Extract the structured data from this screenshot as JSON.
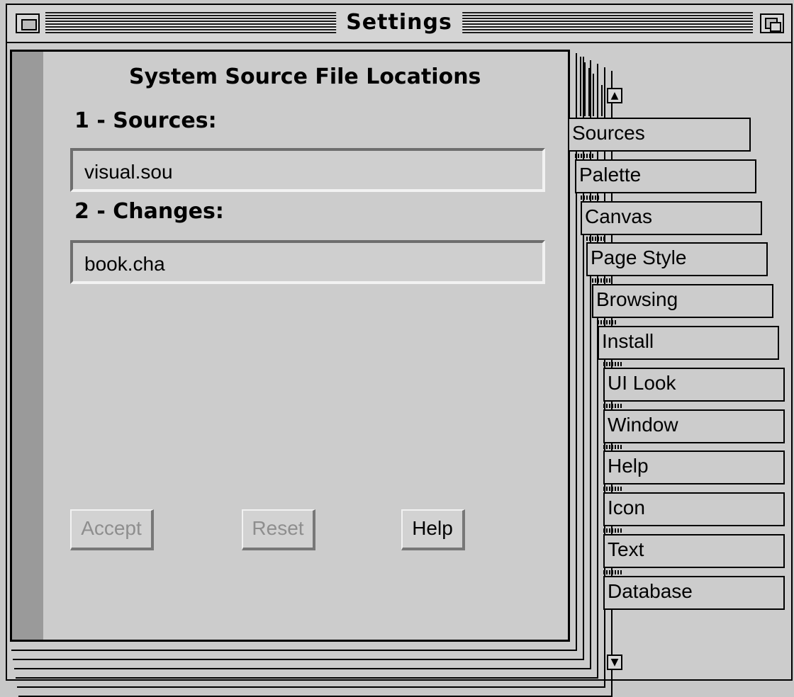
{
  "window": {
    "title": "Settings"
  },
  "panel": {
    "title": "System Source File Locations",
    "sources_label": "1 - Sources:",
    "sources_value": "visual.sou",
    "changes_label": "2 - Changes:",
    "changes_value": "book.cha"
  },
  "buttons": {
    "accept": "Accept",
    "reset": "Reset",
    "help": "Help"
  },
  "tabs": [
    {
      "label": "Sources",
      "active": true
    },
    {
      "label": "Palette"
    },
    {
      "label": "Canvas"
    },
    {
      "label": "Page Style"
    },
    {
      "label": "Browsing"
    },
    {
      "label": "Install"
    },
    {
      "label": "UI Look"
    },
    {
      "label": "Window"
    },
    {
      "label": "Help"
    },
    {
      "label": "Icon"
    },
    {
      "label": "Text"
    },
    {
      "label": "Database"
    }
  ],
  "icons": {
    "close": "close-box-icon",
    "zoom": "zoom-box-icon",
    "scroll_up": "scroll-up-icon",
    "scroll_down": "scroll-down-icon"
  }
}
